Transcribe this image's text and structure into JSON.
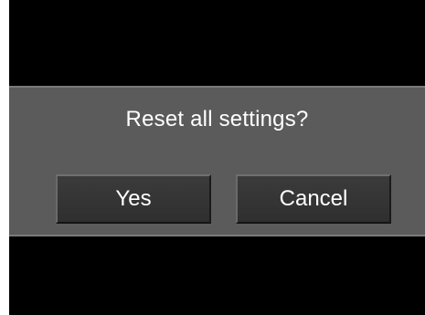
{
  "dialog": {
    "message": "Reset all settings?",
    "buttons": {
      "yes_label": "Yes",
      "cancel_label": "Cancel"
    }
  },
  "colors": {
    "background": "#000000",
    "dialog_band": "#5b5b5b",
    "button_fill": "#333333",
    "text": "#ffffff"
  }
}
